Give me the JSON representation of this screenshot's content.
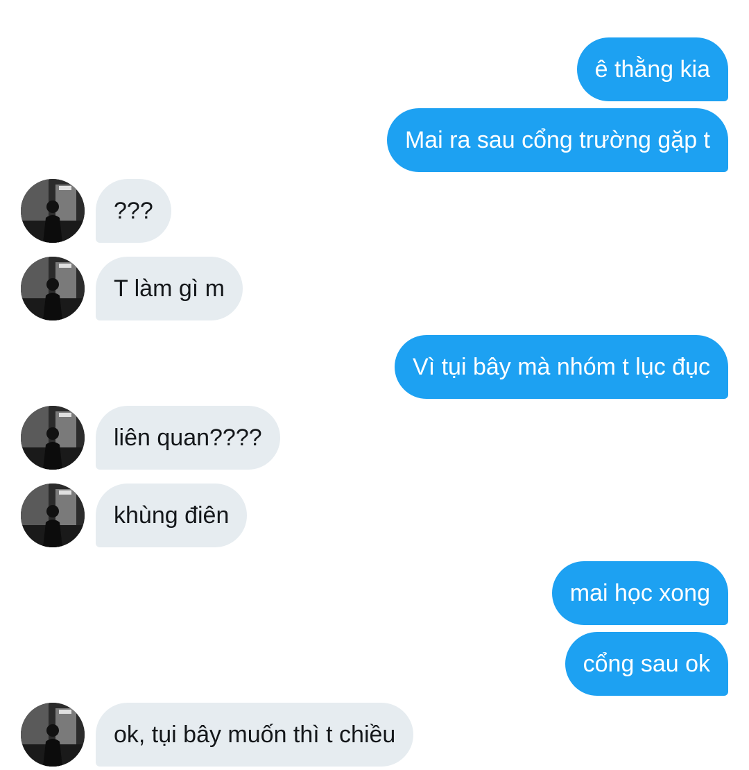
{
  "conversation": {
    "messages": [
      {
        "direction": "outgoing",
        "text": "ê thằng kia"
      },
      {
        "direction": "outgoing",
        "text": "Mai ra sau cổng trường gặp t"
      },
      {
        "direction": "incoming",
        "text": "???",
        "avatar": "contact-avatar-photo"
      },
      {
        "direction": "incoming",
        "text": "T làm gì m",
        "avatar": "contact-avatar-photo"
      },
      {
        "direction": "outgoing",
        "text": "Vì tụi bây mà nhóm t lục đục"
      },
      {
        "direction": "incoming",
        "text": "liên quan????",
        "avatar": "contact-avatar-photo"
      },
      {
        "direction": "incoming",
        "text": "khùng điên",
        "avatar": "contact-avatar-photo"
      },
      {
        "direction": "outgoing",
        "text": "mai học xong"
      },
      {
        "direction": "outgoing",
        "text": "cổng sau ok"
      },
      {
        "direction": "incoming",
        "text": "ok, tụi bây muốn thì t chiều",
        "avatar": "contact-avatar-photo"
      }
    ]
  },
  "colors": {
    "outgoing_bubble": "#1da1f2",
    "incoming_bubble": "#e6ecf0",
    "outgoing_text": "#ffffff",
    "incoming_text": "#14171a"
  }
}
